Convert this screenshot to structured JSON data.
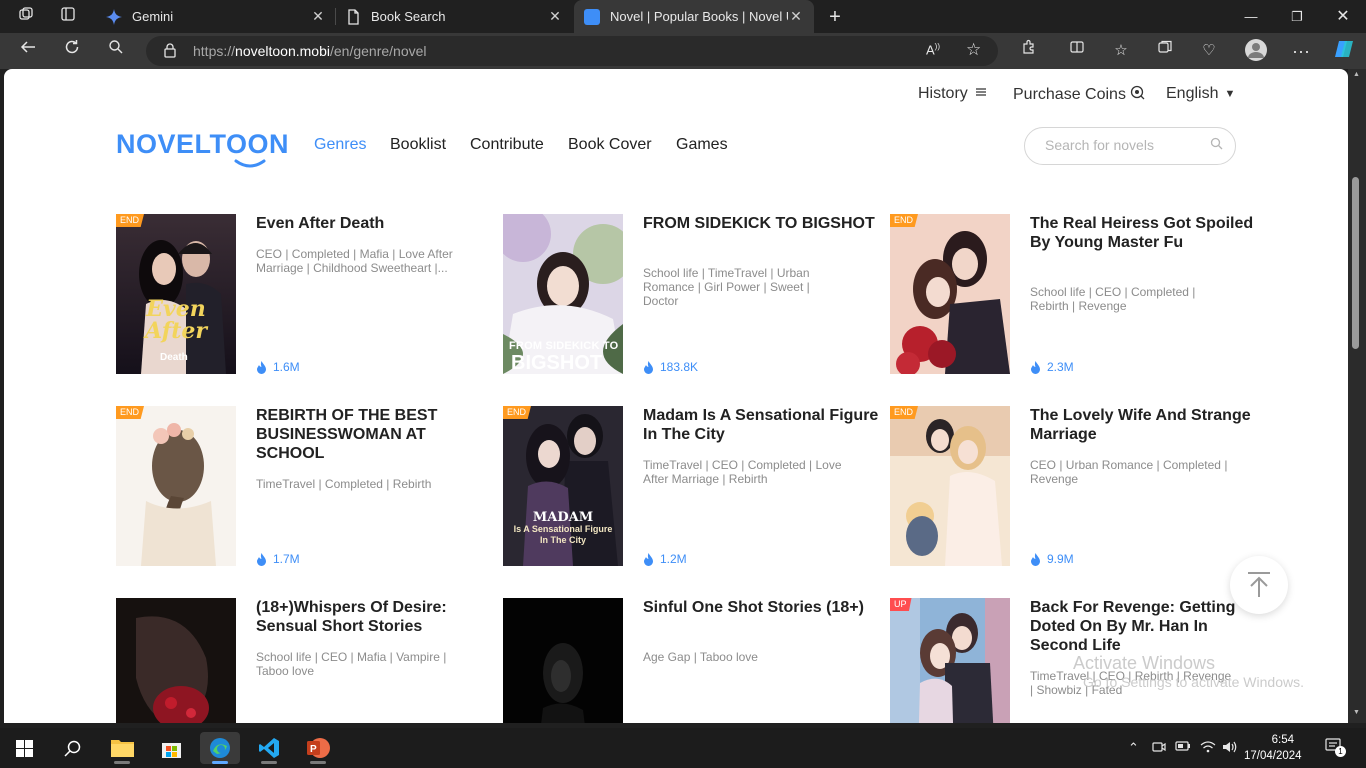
{
  "browser": {
    "tabs": [
      {
        "title": "Gemini",
        "active": false
      },
      {
        "title": "Book Search",
        "active": false
      },
      {
        "title": "Novel | Popular Books | Novel Up",
        "active": true
      }
    ],
    "url_scheme": "https://",
    "url_host": "noveltoon.mobi",
    "url_path": "/en/genre/novel"
  },
  "site": {
    "top_links": {
      "history": "History",
      "purchase": "Purchase Coins",
      "language": "English"
    },
    "logo": "NOVELTOON",
    "nav": [
      "Genres",
      "Booklist",
      "Contribute",
      "Book Cover",
      "Games"
    ],
    "active_nav": "Genres",
    "search_placeholder": "Search for novels"
  },
  "books": [
    {
      "title": "Even After Death",
      "genres": "CEO | Completed | Mafia | Love After Marriage | Childhood Sweetheart |...",
      "views": "1.6M",
      "tag": "END",
      "cover_text": "Even After",
      "cover_sub": "Death",
      "colors": [
        "#2a1f25",
        "#7a5a6e"
      ]
    },
    {
      "title": "FROM SIDEKICK TO BIGSHOT",
      "genres": "School life | TimeTravel | Urban Romance | Girl Power | Sweet | Doctor",
      "views": "183.8K",
      "tag": "",
      "cover_text": "FROM SIDEKICK TO",
      "cover_sub": "BIGSHOT",
      "colors": [
        "#e8e4ef",
        "#5d6f5a"
      ]
    },
    {
      "title": "The Real Heiress Got Spoiled By Young Master Fu",
      "genres": "School life | CEO | Completed | Rebirth | Revenge",
      "views": "2.3M",
      "tag": "END",
      "cover_text": "",
      "cover_sub": "",
      "colors": [
        "#f4d7cc",
        "#9b2430"
      ]
    },
    {
      "title": "REBIRTH OF THE BEST BUSINESSWOMAN AT SCHOOL",
      "genres": "TimeTravel | Completed | Rebirth",
      "views": "1.7M",
      "tag": "END",
      "cover_text": "",
      "cover_sub": "",
      "colors": [
        "#f3ede6",
        "#b9a89a"
      ]
    },
    {
      "title": "Madam Is A Sensational Figure In The City",
      "genres": "TimeTravel | CEO | Completed | Love After Marriage | Rebirth",
      "views": "1.2M",
      "tag": "END",
      "cover_text": "MADAM",
      "cover_sub": "Is A Sensational Figure In The City",
      "colors": [
        "#2c2a33",
        "#5b4d6b"
      ]
    },
    {
      "title": "The Lovely Wife And Strange Marriage",
      "genres": "CEO | Urban Romance | Completed | Revenge",
      "views": "9.9M",
      "tag": "END",
      "cover_text": "",
      "cover_sub": "",
      "colors": [
        "#f6e7d6",
        "#d59b7a"
      ]
    },
    {
      "title": "(18+)Whispers Of Desire: Sensual Short Stories",
      "genres": "School life | CEO | Mafia | Vampire | Taboo love",
      "views": "",
      "tag": "",
      "cover_text": "",
      "cover_sub": "",
      "colors": [
        "#1b1416",
        "#8e1522"
      ]
    },
    {
      "title": "Sinful One Shot Stories (18+)",
      "genres": "Age Gap | Taboo love",
      "views": "",
      "tag": "",
      "cover_text": "",
      "cover_sub": "",
      "colors": [
        "#050505",
        "#3a3a3a"
      ]
    },
    {
      "title": "Back For Revenge: Getting Doted On By Mr. Han In Second Life",
      "genres": "TimeTravel | CEO | Rebirth | Revenge | Showbiz | Fated",
      "views": "",
      "tag": "UP",
      "cover_text": "",
      "cover_sub": "",
      "colors": [
        "#8fb4d8",
        "#5a3b4a"
      ]
    }
  ],
  "watermark": {
    "line1": "Activate Windows",
    "line2": "Go to Settings to activate Windows."
  },
  "clock": {
    "time": "6:54",
    "date": "17/04/2024"
  },
  "notification_count": "1",
  "accent": "#3e8ef7",
  "tag_colors": {
    "end": "#ff9a1f",
    "up": "#ff4d4f"
  }
}
